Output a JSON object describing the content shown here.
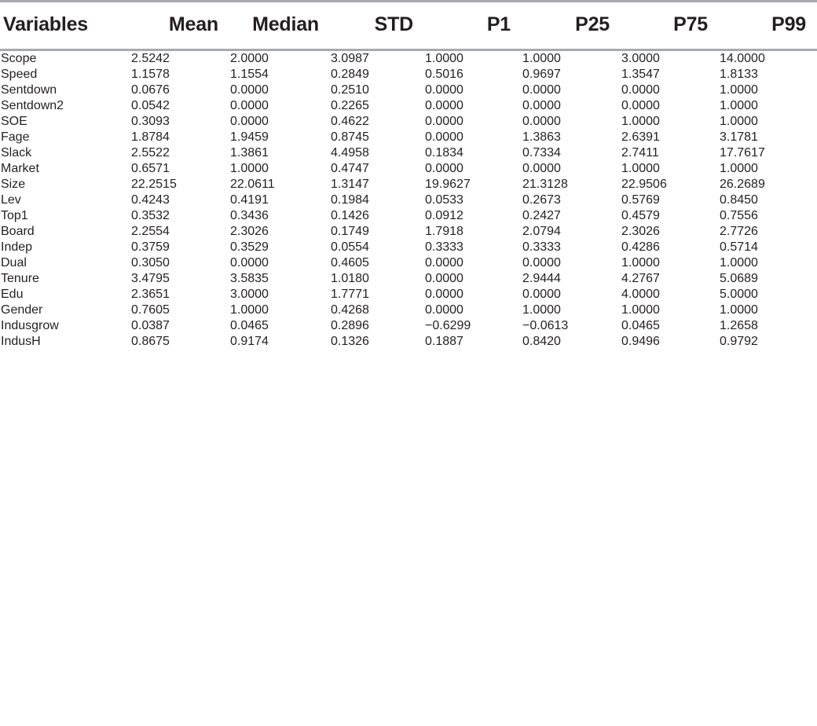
{
  "table": {
    "columns": [
      "Variables",
      "Mean",
      "Median",
      "STD",
      "P1",
      "P25",
      "P75",
      "P99"
    ],
    "rows": [
      {
        "variable": "Scope",
        "values": [
          "2.5242",
          "2.0000",
          "3.0987",
          "1.0000",
          "1.0000",
          "3.0000",
          "14.0000"
        ]
      },
      {
        "variable": "Speed",
        "values": [
          "1.1578",
          "1.1554",
          "0.2849",
          "0.5016",
          "0.9697",
          "1.3547",
          "1.8133"
        ]
      },
      {
        "variable": "Sentdown",
        "values": [
          "0.0676",
          "0.0000",
          "0.2510",
          "0.0000",
          "0.0000",
          "0.0000",
          "1.0000"
        ]
      },
      {
        "variable": "Sentdown2",
        "values": [
          "0.0542",
          "0.0000",
          "0.2265",
          "0.0000",
          "0.0000",
          "0.0000",
          "1.0000"
        ]
      },
      {
        "variable": "SOE",
        "values": [
          "0.3093",
          "0.0000",
          "0.4622",
          "0.0000",
          "0.0000",
          "1.0000",
          "1.0000"
        ]
      },
      {
        "variable": "Fage",
        "values": [
          "1.8784",
          "1.9459",
          "0.8745",
          "0.0000",
          "1.3863",
          "2.6391",
          "3.1781"
        ]
      },
      {
        "variable": "Slack",
        "values": [
          "2.5522",
          "1.3861",
          "4.4958",
          "0.1834",
          "0.7334",
          "2.7411",
          "17.7617"
        ]
      },
      {
        "variable": "Market",
        "values": [
          "0.6571",
          "1.0000",
          "0.4747",
          "0.0000",
          "0.0000",
          "1.0000",
          "1.0000"
        ]
      },
      {
        "variable": "Size",
        "values": [
          "22.2515",
          "22.0611",
          "1.3147",
          "19.9627",
          "21.3128",
          "22.9506",
          "26.2689"
        ]
      },
      {
        "variable": "Lev",
        "values": [
          "0.4243",
          "0.4191",
          "0.1984",
          "0.0533",
          "0.2673",
          "0.5769",
          "0.8450"
        ]
      },
      {
        "variable": "Top1",
        "values": [
          "0.3532",
          "0.3436",
          "0.1426",
          "0.0912",
          "0.2427",
          "0.4579",
          "0.7556"
        ]
      },
      {
        "variable": "Board",
        "values": [
          "2.2554",
          "2.3026",
          "0.1749",
          "1.7918",
          "2.0794",
          "2.3026",
          "2.7726"
        ]
      },
      {
        "variable": "Indep",
        "values": [
          "0.3759",
          "0.3529",
          "0.0554",
          "0.3333",
          "0.3333",
          "0.4286",
          "0.5714"
        ]
      },
      {
        "variable": "Dual",
        "values": [
          "0.3050",
          "0.0000",
          "0.4605",
          "0.0000",
          "0.0000",
          "1.0000",
          "1.0000"
        ]
      },
      {
        "variable": "Tenure",
        "values": [
          "3.4795",
          "3.5835",
          "1.0180",
          "0.0000",
          "2.9444",
          "4.2767",
          "5.0689"
        ]
      },
      {
        "variable": "Edu",
        "values": [
          "2.3651",
          "3.0000",
          "1.7771",
          "0.0000",
          "0.0000",
          "4.0000",
          "5.0000"
        ]
      },
      {
        "variable": "Gender",
        "values": [
          "0.7605",
          "1.0000",
          "0.4268",
          "0.0000",
          "1.0000",
          "1.0000",
          "1.0000"
        ]
      },
      {
        "variable": "Indusgrow",
        "values": [
          "0.0387",
          "0.0465",
          "0.2896",
          "−0.6299",
          "−0.0613",
          "0.0465",
          "1.2658"
        ]
      },
      {
        "variable": "IndusH",
        "values": [
          "0.8675",
          "0.9174",
          "0.1326",
          "0.1887",
          "0.8420",
          "0.9496",
          "0.9792"
        ]
      }
    ]
  },
  "chart_data": {
    "type": "table",
    "title": "",
    "columns": [
      "Variables",
      "Mean",
      "Median",
      "STD",
      "P1",
      "P25",
      "P75",
      "P99"
    ],
    "rows": [
      [
        "Scope",
        2.5242,
        2.0,
        3.0987,
        1.0,
        1.0,
        3.0,
        14.0
      ],
      [
        "Speed",
        1.1578,
        1.1554,
        0.2849,
        0.5016,
        0.9697,
        1.3547,
        1.8133
      ],
      [
        "Sentdown",
        0.0676,
        0.0,
        0.251,
        0.0,
        0.0,
        0.0,
        1.0
      ],
      [
        "Sentdown2",
        0.0542,
        0.0,
        0.2265,
        0.0,
        0.0,
        0.0,
        1.0
      ],
      [
        "SOE",
        0.3093,
        0.0,
        0.4622,
        0.0,
        0.0,
        1.0,
        1.0
      ],
      [
        "Fage",
        1.8784,
        1.9459,
        0.8745,
        0.0,
        1.3863,
        2.6391,
        3.1781
      ],
      [
        "Slack",
        2.5522,
        1.3861,
        4.4958,
        0.1834,
        0.7334,
        2.7411,
        17.7617
      ],
      [
        "Market",
        0.6571,
        1.0,
        0.4747,
        0.0,
        0.0,
        1.0,
        1.0
      ],
      [
        "Size",
        22.2515,
        22.0611,
        1.3147,
        19.9627,
        21.3128,
        22.9506,
        26.2689
      ],
      [
        "Lev",
        0.4243,
        0.4191,
        0.1984,
        0.0533,
        0.2673,
        0.5769,
        0.845
      ],
      [
        "Top1",
        0.3532,
        0.3436,
        0.1426,
        0.0912,
        0.2427,
        0.4579,
        0.7556
      ],
      [
        "Board",
        2.2554,
        2.3026,
        0.1749,
        1.7918,
        2.0794,
        2.3026,
        2.7726
      ],
      [
        "Indep",
        0.3759,
        0.3529,
        0.0554,
        0.3333,
        0.3333,
        0.4286,
        0.5714
      ],
      [
        "Dual",
        0.305,
        0.0,
        0.4605,
        0.0,
        0.0,
        1.0,
        1.0
      ],
      [
        "Tenure",
        3.4795,
        3.5835,
        1.018,
        0.0,
        2.9444,
        4.2767,
        5.0689
      ],
      [
        "Edu",
        2.3651,
        3.0,
        1.7771,
        0.0,
        0.0,
        4.0,
        5.0
      ],
      [
        "Gender",
        0.7605,
        1.0,
        0.4268,
        0.0,
        1.0,
        1.0,
        1.0
      ],
      [
        "Indusgrow",
        0.0387,
        0.0465,
        0.2896,
        -0.6299,
        -0.0613,
        0.0465,
        1.2658
      ],
      [
        "IndusH",
        0.8675,
        0.9174,
        0.1326,
        0.1887,
        0.842,
        0.9496,
        0.9792
      ]
    ]
  }
}
